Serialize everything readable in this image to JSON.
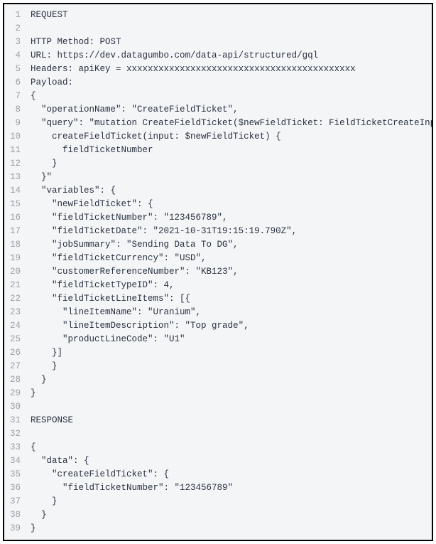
{
  "code": {
    "lines": [
      "REQUEST",
      "",
      "HTTP Method: POST",
      "URL: https://dev.datagumbo.com/data-api/structured/gql",
      "Headers: apiKey = xxxxxxxxxxxxxxxxxxxxxxxxxxxxxxxxxxxxxxxxxxx",
      "Payload:",
      "{",
      "  \"operationName\": \"CreateFieldTicket\",",
      "  \"query\": \"mutation CreateFieldTicket($newFieldTicket: FieldTicketCreateInput!) {",
      "    createFieldTicket(input: $newFieldTicket) {",
      "      fieldTicketNumber",
      "    }",
      "  }\"",
      "  \"variables\": {",
      "    \"newFieldTicket\": {",
      "    \"fieldTicketNumber\": \"123456789\",",
      "    \"fieldTicketDate\": \"2021-10-31T19:15:19.790Z\",",
      "    \"jobSummary\": \"Sending Data To DG\",",
      "    \"fieldTicketCurrency\": \"USD\",",
      "    \"customerReferenceNumber\": \"KB123\",",
      "    \"fieldTicketTypeID\": 4,",
      "    \"fieldTicketLineItems\": [{",
      "      \"lineItemName\": \"Uranium\",",
      "      \"lineItemDescription\": \"Top grade\",",
      "      \"productLineCode\": \"U1\"",
      "    }]",
      "    }",
      "  }",
      "}",
      "",
      "RESPONSE",
      "",
      "{",
      "  \"data\": {",
      "    \"createFieldTicket\": {",
      "      \"fieldTicketNumber\": \"123456789\"",
      "    }",
      "  }",
      "}"
    ]
  }
}
